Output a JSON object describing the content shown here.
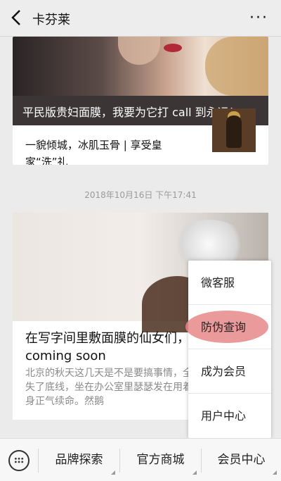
{
  "header": {
    "title": "卡芬莱",
    "back_icon": "back-arrow-icon",
    "more_icon": "more-dots-icon",
    "more_label": "···"
  },
  "card1": {
    "headline": "平民版贵妇面膜，我要为它打 call 到永远！",
    "text": "一貌倾城，冰肌玉骨 | 享受皇家“洗”礼"
  },
  "timestamp": "2018年10月16日 下午17:41",
  "card2": {
    "title": "在写字间里敷面膜的仙女们，\ncoming soon",
    "desc": "北京的秋天这几天是不是要搞事情，全丧失了底线，坐在办公室里瑟瑟发在用着一身正气续命。然鹅"
  },
  "menu": {
    "items": [
      {
        "label": "微客服"
      },
      {
        "label": "防伪查询"
      },
      {
        "label": "成为会员"
      },
      {
        "label": "用户中心"
      }
    ],
    "highlight_color": "#e8888a"
  },
  "bottombar": {
    "tabs": [
      {
        "label": "品牌探索"
      },
      {
        "label": "官方商城"
      },
      {
        "label": "会员中心"
      }
    ],
    "keyboard_icon": "keyboard-icon"
  }
}
